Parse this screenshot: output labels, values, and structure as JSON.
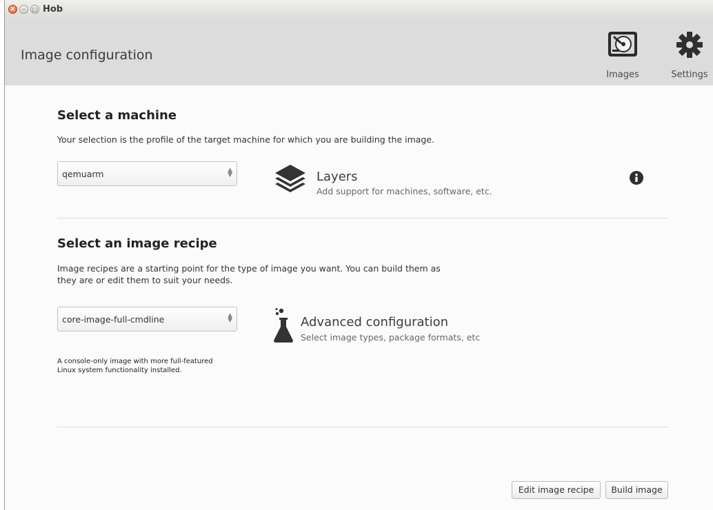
{
  "window": {
    "title": "Hob"
  },
  "header": {
    "title": "Image configuration",
    "images_label": "Images",
    "settings_label": "Settings"
  },
  "machine": {
    "heading": "Select a machine",
    "description": "Your selection is the profile of the target machine for which you are building the image.",
    "selected": "qemuarm",
    "layers_title": "Layers",
    "layers_subtitle": "Add support for machines, software, etc."
  },
  "recipe": {
    "heading": "Select an image recipe",
    "description_line1": "Image recipes are a starting point for the type of image you want. You can build them as",
    "description_line2": "they are or edit them to suit your needs.",
    "selected": "core-image-full-cmdline",
    "recipe_note_line1": "A console-only image with more full-featured",
    "recipe_note_line2": "Linux system functionality installed.",
    "advanced_title": "Advanced configuration",
    "advanced_subtitle": "Select image types, package formats, etc"
  },
  "footer": {
    "edit_label": "Edit image recipe",
    "build_label": "Build image"
  }
}
